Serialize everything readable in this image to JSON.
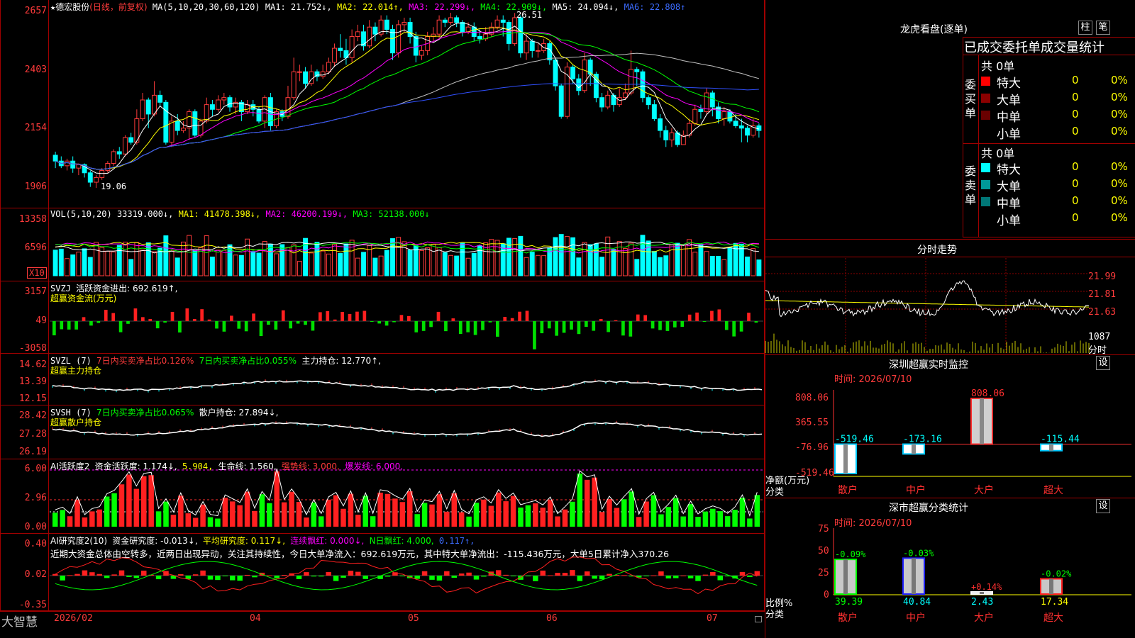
{
  "stock": {
    "name": "德宏股份",
    "period": "(日线，前复权)",
    "star": "★"
  },
  "main_ma": {
    "prefix": "MA(5,10,20,30,60,120)",
    "ma1": "MA1: 21.752↓,",
    "ma2": "MA2: 22.014↑,",
    "ma3": "MA3: 22.299↓,",
    "ma4": "MA4: 22.909↓,",
    "ma5": "MA5: 24.094↓,",
    "ma6": "MA6: 22.808↑"
  },
  "price_axis": [
    "2657",
    "2403",
    "2154",
    "1906"
  ],
  "price_marks": {
    "high": "26.51",
    "low": "19.06"
  },
  "vol": {
    "label": "VOL(5,10,20)",
    "value": "33319.000↓,",
    "ma1": "MA1: 41478.398↓,",
    "ma2": "MA2: 46200.199↓,",
    "ma3": "MA3: 52138.000↓",
    "axis": [
      "13358",
      "6596"
    ],
    "unit": "X10"
  },
  "svzj": {
    "label": "SVZJ",
    "text": "活跃资金进出: 692.619↑,",
    "title": "超赢资金流(万元)",
    "axis": [
      "3157",
      "49",
      "-3058"
    ]
  },
  "svzl": {
    "label": "SVZL (7)",
    "a": "7日内买卖净占比0.126%",
    "b": "7日内买卖净占比0.055%",
    "c": "主力持仓: 12.770↑,",
    "title": "超赢主力持仓",
    "axis": [
      "14.62",
      "13.39",
      "12.15"
    ]
  },
  "svsh": {
    "label": "SVSH (7)",
    "a": "7日内买卖净占比0.065%",
    "b": "散户持仓: 27.894↓,",
    "title": "超赢散户持仓",
    "axis": [
      "28.42",
      "27.28",
      "26.19"
    ]
  },
  "ai1": {
    "label": "AI活跃度2",
    "a": "资金活跃度: 1.174↓,",
    "b": "5.904,",
    "c": "生命线: 1.560,",
    "d": "强势线: 3.000,",
    "e": "爆发线: 6.000,",
    "axis": [
      "6.00",
      "2.96",
      "0.00"
    ]
  },
  "ai2": {
    "label": "AI研究度2(10)",
    "a": "资金研究度: -0.013↓,",
    "b": "平均研究度: 0.117↓,",
    "c": "连续飘红: 0.000↓,",
    "d": "N日飘红: 4.000,",
    "e": "0.117↑,",
    "note": "近期大资金总体由空转多，近两日出现异动，关注其持续性，今日大单净流入：692.619万元，其中特大单净流出：-115.436万元，大单5日累计净入370.26",
    "axis": [
      "0.40",
      "0.02",
      "-0.35"
    ]
  },
  "time_axis": {
    "brand": "大智慧",
    "labels": [
      "2026/02",
      "04",
      "05",
      "06",
      "07"
    ]
  },
  "dragon": {
    "title": "龙虎看盘(逐单)",
    "btn1": "柱",
    "btn2": "笔",
    "subtitle": "已成交委托单成交量统计",
    "buy_label": "委买单",
    "sell_label": "委卖单",
    "buy_total": "共 0单",
    "sell_total": "共 0单",
    "buy_rows": [
      {
        "name": "特大",
        "count": "0",
        "pct": "0%",
        "color": "#ff0000"
      },
      {
        "name": "大单",
        "count": "0",
        "pct": "0%",
        "color": "#8b0000"
      },
      {
        "name": "中单",
        "count": "0",
        "pct": "0%",
        "color": "#6a0000"
      },
      {
        "name": "小单",
        "count": "0",
        "pct": "0%",
        "color": ""
      }
    ],
    "sell_rows": [
      {
        "name": "特大",
        "count": "0",
        "pct": "0%",
        "color": "#00ffff"
      },
      {
        "name": "大单",
        "count": "0",
        "pct": "0%",
        "color": "#009999"
      },
      {
        "name": "中单",
        "count": "0",
        "pct": "0%",
        "color": "#007777"
      },
      {
        "name": "小单",
        "count": "0",
        "pct": "0%",
        "color": ""
      }
    ]
  },
  "intraday": {
    "title": "分时走势",
    "axis": [
      "21.99",
      "21.81",
      "21.63"
    ],
    "vol_label": "1087",
    "unit": "分时"
  },
  "sz_monitor": {
    "title": "深圳超赢实时监控",
    "btn": "设",
    "time": "时间: 2026/07/10",
    "axis": [
      "808.06",
      "365.55",
      "-76.96",
      "-519.46"
    ],
    "ylabel1": "净额(万元)",
    "ylabel2": "分类",
    "categories": [
      "散户",
      "中户",
      "大户",
      "超大"
    ],
    "values": [
      -519.46,
      -173.16,
      808.06,
      -115.44
    ],
    "value_labels": [
      "-519.46",
      "-173.16",
      "808.06",
      "-115.44"
    ]
  },
  "sz_class": {
    "title": "深市超赢分类统计",
    "btn": "设",
    "time": "时间: 2026/07/10",
    "axis": [
      "75",
      "50",
      "25",
      "0"
    ],
    "ylabel1": "比例%",
    "ylabel2": "分类",
    "categories": [
      "散户",
      "中户",
      "大户",
      "超大"
    ],
    "values": [
      39.39,
      40.84,
      2.43,
      17.34
    ],
    "changes": [
      "-0.09%",
      "-0.03%",
      "+0.14%",
      "-0.02%"
    ],
    "value_labels": [
      "39.39",
      "40.84",
      "2.43",
      "17.34"
    ]
  },
  "chart_data": {
    "type": "candlestick",
    "ylim": [
      19.06,
      26.57
    ],
    "candles": [
      [
        20.45,
        20.2,
        20.6,
        19.9
      ],
      [
        20.2,
        20.0,
        20.4,
        19.9
      ],
      [
        20.0,
        20.2,
        20.3,
        19.8
      ],
      [
        20.2,
        19.9,
        20.4,
        19.7
      ],
      [
        19.9,
        20.05,
        20.1,
        19.6
      ],
      [
        20.05,
        19.7,
        20.1,
        19.5
      ],
      [
        19.7,
        19.3,
        19.8,
        19.1
      ],
      [
        19.3,
        19.5,
        19.6,
        19.06
      ],
      [
        19.5,
        19.8,
        19.9,
        19.4
      ],
      [
        19.8,
        20.1,
        20.2,
        19.7
      ],
      [
        20.1,
        20.6,
        20.7,
        20.0
      ],
      [
        20.6,
        20.5,
        20.8,
        20.3
      ],
      [
        20.5,
        21.2,
        21.3,
        20.4
      ],
      [
        21.2,
        21.0,
        21.4,
        20.9
      ],
      [
        21.0,
        22.0,
        22.4,
        20.9
      ],
      [
        22.0,
        22.8,
        23.1,
        21.9
      ],
      [
        22.8,
        22.2,
        22.9,
        21.6
      ],
      [
        22.2,
        23.0,
        23.6,
        22.1
      ],
      [
        23.0,
        22.7,
        23.2,
        22.5
      ],
      [
        22.7,
        21.0,
        22.8,
        20.9
      ],
      [
        21.0,
        21.9,
        22.1,
        20.8
      ],
      [
        21.9,
        21.5,
        22.2,
        21.3
      ],
      [
        21.5,
        21.6,
        21.9,
        21.4
      ],
      [
        21.6,
        22.3,
        22.4,
        21.1
      ],
      [
        22.3,
        21.3,
        22.4,
        21.2
      ],
      [
        21.3,
        21.9,
        22.0,
        21.2
      ],
      [
        21.9,
        22.6,
        22.9,
        21.8
      ],
      [
        22.6,
        22.4,
        22.8,
        22.1
      ],
      [
        22.4,
        22.8,
        23.0,
        22.3
      ],
      [
        22.8,
        22.9,
        23.1,
        22.6
      ],
      [
        22.9,
        22.5,
        23.0,
        22.3
      ],
      [
        22.5,
        22.7,
        22.9,
        22.2
      ],
      [
        22.7,
        22.3,
        22.8,
        21.9
      ],
      [
        22.3,
        22.6,
        22.8,
        22.2
      ],
      [
        22.6,
        22.4,
        22.8,
        22.1
      ],
      [
        22.4,
        21.9,
        22.5,
        21.8
      ],
      [
        21.9,
        22.9,
        23.0,
        21.6
      ],
      [
        22.9,
        21.7,
        23.1,
        21.5
      ],
      [
        21.7,
        22.3,
        22.4,
        21.6
      ],
      [
        22.3,
        22.1,
        22.4,
        21.9
      ],
      [
        22.1,
        22.9,
        23.4,
        22.0
      ],
      [
        22.9,
        24.0,
        24.6,
        22.8
      ],
      [
        24.0,
        24.0,
        24.3,
        23.6
      ],
      [
        24.0,
        23.5,
        24.2,
        23.3
      ],
      [
        23.5,
        24.0,
        24.3,
        23.4
      ],
      [
        24.0,
        23.8,
        24.1,
        23.6
      ],
      [
        23.8,
        24.0,
        24.3,
        23.7
      ],
      [
        24.0,
        24.4,
        24.6,
        23.9
      ],
      [
        24.4,
        25.0,
        25.2,
        24.2
      ],
      [
        25.0,
        24.9,
        25.6,
        24.6
      ],
      [
        24.9,
        24.6,
        25.4,
        24.3
      ],
      [
        24.6,
        25.5,
        25.8,
        24.4
      ],
      [
        25.5,
        25.7,
        26.0,
        25.3
      ],
      [
        25.7,
        25.1,
        26.0,
        24.9
      ],
      [
        25.1,
        25.9,
        26.2,
        25.0
      ],
      [
        25.9,
        25.6,
        26.1,
        25.3
      ],
      [
        25.6,
        26.2,
        26.4,
        25.5
      ],
      [
        26.2,
        25.8,
        26.4,
        25.6
      ],
      [
        25.8,
        24.8,
        26.0,
        24.5
      ],
      [
        24.8,
        26.0,
        26.2,
        24.6
      ],
      [
        26.0,
        26.1,
        26.3,
        25.7
      ],
      [
        26.1,
        25.5,
        26.3,
        25.2
      ],
      [
        25.5,
        24.7,
        25.7,
        24.4
      ],
      [
        24.7,
        24.9,
        25.1,
        24.5
      ],
      [
        24.9,
        25.5,
        25.7,
        24.7
      ],
      [
        25.5,
        25.6,
        25.9,
        25.3
      ],
      [
        25.6,
        26.2,
        26.4,
        25.4
      ],
      [
        26.2,
        26.1,
        26.3,
        25.9
      ],
      [
        26.1,
        26.3,
        26.51,
        26.0
      ],
      [
        26.3,
        26.1,
        26.4,
        25.9
      ],
      [
        26.1,
        25.7,
        26.2,
        25.5
      ],
      [
        25.7,
        25.9,
        26.1,
        25.6
      ],
      [
        25.9,
        25.5,
        26.1,
        25.3
      ],
      [
        25.5,
        25.4,
        25.8,
        25.2
      ],
      [
        25.4,
        25.6,
        25.9,
        25.3
      ],
      [
        25.6,
        25.9,
        26.1,
        25.5
      ],
      [
        25.9,
        26.2,
        26.4,
        25.8
      ],
      [
        26.2,
        26.1,
        26.4,
        25.5
      ],
      [
        26.1,
        25.2,
        26.2,
        24.9
      ],
      [
        25.2,
        26.3,
        26.5,
        25.1
      ],
      [
        26.3,
        24.8,
        26.4,
        24.6
      ],
      [
        24.8,
        25.3,
        25.6,
        24.5
      ],
      [
        25.3,
        24.9,
        25.4,
        24.6
      ],
      [
        24.9,
        24.9,
        25.2,
        24.6
      ],
      [
        24.9,
        25.2,
        25.4,
        24.8
      ],
      [
        25.2,
        24.5,
        25.3,
        24.3
      ],
      [
        24.5,
        23.4,
        24.6,
        23.2
      ],
      [
        23.4,
        22.1,
        23.5,
        22.0
      ],
      [
        22.1,
        24.2,
        24.4,
        22.0
      ],
      [
        24.2,
        23.7,
        24.3,
        23.5
      ],
      [
        23.7,
        23.2,
        23.9,
        23.0
      ],
      [
        23.2,
        24.5,
        24.8,
        23.1
      ],
      [
        24.5,
        23.9,
        24.6,
        23.4
      ],
      [
        23.9,
        22.9,
        24.0,
        22.7
      ],
      [
        22.9,
        22.5,
        23.1,
        22.3
      ],
      [
        22.5,
        23.0,
        23.2,
        22.4
      ],
      [
        23.0,
        22.6,
        23.1,
        22.3
      ],
      [
        22.6,
        22.9,
        23.3,
        22.5
      ],
      [
        22.9,
        23.1,
        23.5,
        22.8
      ],
      [
        23.1,
        24.1,
        24.9,
        23.0
      ],
      [
        24.1,
        24.0,
        24.2,
        23.4
      ],
      [
        24.0,
        22.9,
        24.1,
        22.7
      ],
      [
        22.9,
        22.6,
        23.0,
        22.4
      ],
      [
        22.6,
        22.0,
        22.8,
        21.9
      ],
      [
        22.0,
        21.5,
        22.2,
        21.2
      ],
      [
        21.5,
        21.1,
        21.7,
        20.8
      ],
      [
        21.1,
        21.4,
        21.6,
        20.8
      ],
      [
        21.4,
        20.9,
        21.5,
        20.8
      ],
      [
        20.9,
        21.3,
        21.5,
        20.9
      ],
      [
        21.3,
        21.8,
        22.0,
        21.2
      ],
      [
        21.8,
        22.4,
        22.6,
        21.7
      ],
      [
        22.4,
        22.3,
        22.6,
        22.0
      ],
      [
        22.3,
        23.1,
        23.3,
        22.2
      ],
      [
        23.1,
        22.5,
        23.2,
        22.1
      ],
      [
        22.5,
        22.0,
        22.7,
        21.8
      ],
      [
        22.0,
        22.3,
        22.5,
        21.7
      ],
      [
        22.3,
        21.9,
        22.4,
        21.8
      ],
      [
        21.9,
        21.7,
        22.2,
        21.6
      ],
      [
        21.7,
        21.6,
        22.0,
        21.0
      ],
      [
        21.6,
        21.3,
        21.7,
        21.0
      ],
      [
        21.3,
        21.7,
        22.0,
        21.2
      ],
      [
        21.7,
        21.5,
        21.8,
        21.2
      ]
    ]
  }
}
